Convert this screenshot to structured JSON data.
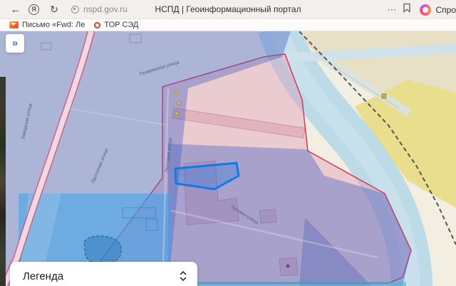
{
  "browser": {
    "back_glyph": "←",
    "browser_menu_glyph": "Я",
    "refresh_glyph": "↻",
    "url": "nspd.gov.ru",
    "page_title": "НСПД | Геоинформационный портал",
    "more_glyph": "⋯",
    "alice_label": "Спро",
    "bookmarks": [
      {
        "label": "Письмо «Fwd: Ле"
      },
      {
        "label": "ТОР СЭД"
      }
    ]
  },
  "map": {
    "expand_glyph": "»",
    "legend_label": "Легенда",
    "street_labels": [
      {
        "text": "Лазаревская улица"
      },
      {
        "text": "Заводская улица"
      },
      {
        "text": "Почтовая улица"
      },
      {
        "text": "Проточная улица"
      },
      {
        "text": "Луговая улица"
      }
    ],
    "colors": {
      "selected_parcel": "#0f7ae8",
      "zone_blue": "#4d66c4",
      "zone_pink_fill": "#de96b4",
      "zone_pink_border": "#d8365c",
      "highlight_cyan": "#3fa3ea",
      "river": "#b7d8e8",
      "field_yellow": "#e9de8e"
    }
  }
}
